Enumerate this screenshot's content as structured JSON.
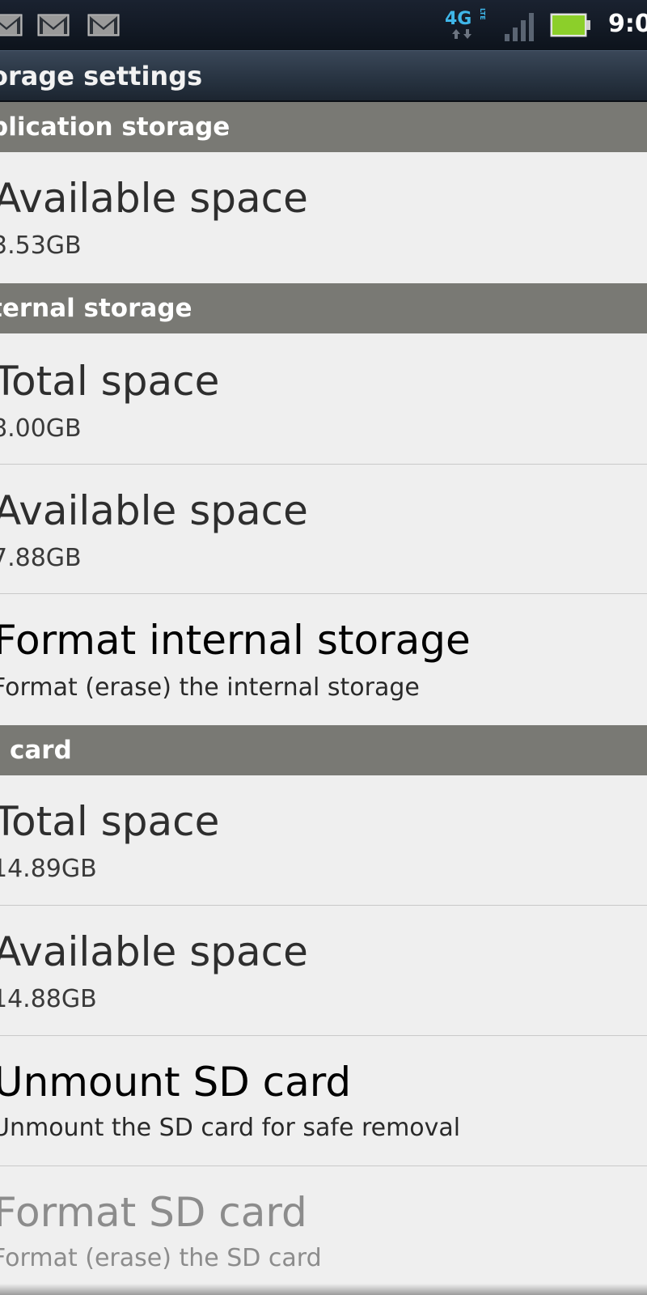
{
  "status_bar": {
    "notification_icons": [
      "gmail-icon",
      "gmail-icon",
      "gmail-icon"
    ],
    "network_label": "4G",
    "network_sublabel": "LTE",
    "time": "9:0",
    "battery_color": "#8ccf2a",
    "network_color": "#3fb6e8"
  },
  "title_bar": {
    "title": "orage settings"
  },
  "sections": {
    "application": {
      "header": "plication storage",
      "available": {
        "title": "Available space",
        "value": "3.53GB"
      }
    },
    "internal": {
      "header": "ternal storage",
      "total": {
        "title": "Total space",
        "value": "8.00GB"
      },
      "available": {
        "title": "Available space",
        "value": "7.88GB"
      },
      "format": {
        "title": "Format internal storage",
        "summary": "Format (erase) the internal storage"
      }
    },
    "sd": {
      "header": "card",
      "total": {
        "title": "Total space",
        "value": "14.89GB"
      },
      "available": {
        "title": "Available space",
        "value": "14.88GB"
      },
      "unmount": {
        "title": "Unmount SD card",
        "summary": "Unmount the SD card for safe removal"
      },
      "format": {
        "title": "Format SD card",
        "summary": "Format (erase) the SD card"
      }
    }
  }
}
